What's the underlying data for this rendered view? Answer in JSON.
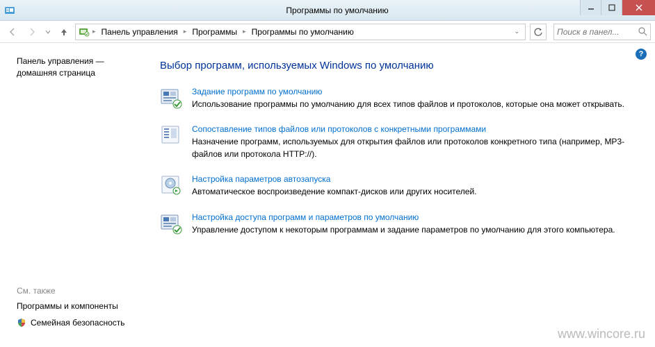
{
  "window": {
    "title": "Программы по умолчанию"
  },
  "breadcrumb": {
    "items": [
      "Панель управления",
      "Программы",
      "Программы по умолчанию"
    ]
  },
  "search": {
    "placeholder": "Поиск в панел..."
  },
  "sidebar": {
    "home": "Панель управления — домашняя страница",
    "see_also": "См. также",
    "links": [
      {
        "label": "Программы и компоненты"
      },
      {
        "label": "Семейная безопасность"
      }
    ]
  },
  "main": {
    "heading": "Выбор программ, используемых Windows по умолчанию",
    "items": [
      {
        "link": "Задание программ по умолчанию",
        "desc": "Использование программы по умолчанию для всех типов файлов и протоколов, которые она может открывать."
      },
      {
        "link": "Сопоставление типов файлов или протоколов с конкретными программами",
        "desc": "Назначение программ, используемых для открытия файлов или протоколов конкретного типа (например, MP3-файлов  или протокола HTTP://)."
      },
      {
        "link": "Настройка параметров автозапуска",
        "desc": "Автоматическое воспроизведение компакт-дисков или других носителей."
      },
      {
        "link": "Настройка доступа программ и параметров по умолчанию",
        "desc": "Управление доступом к некоторым программам и задание параметров по умолчанию для этого компьютера."
      }
    ]
  },
  "watermark": "www.wincore.ru"
}
